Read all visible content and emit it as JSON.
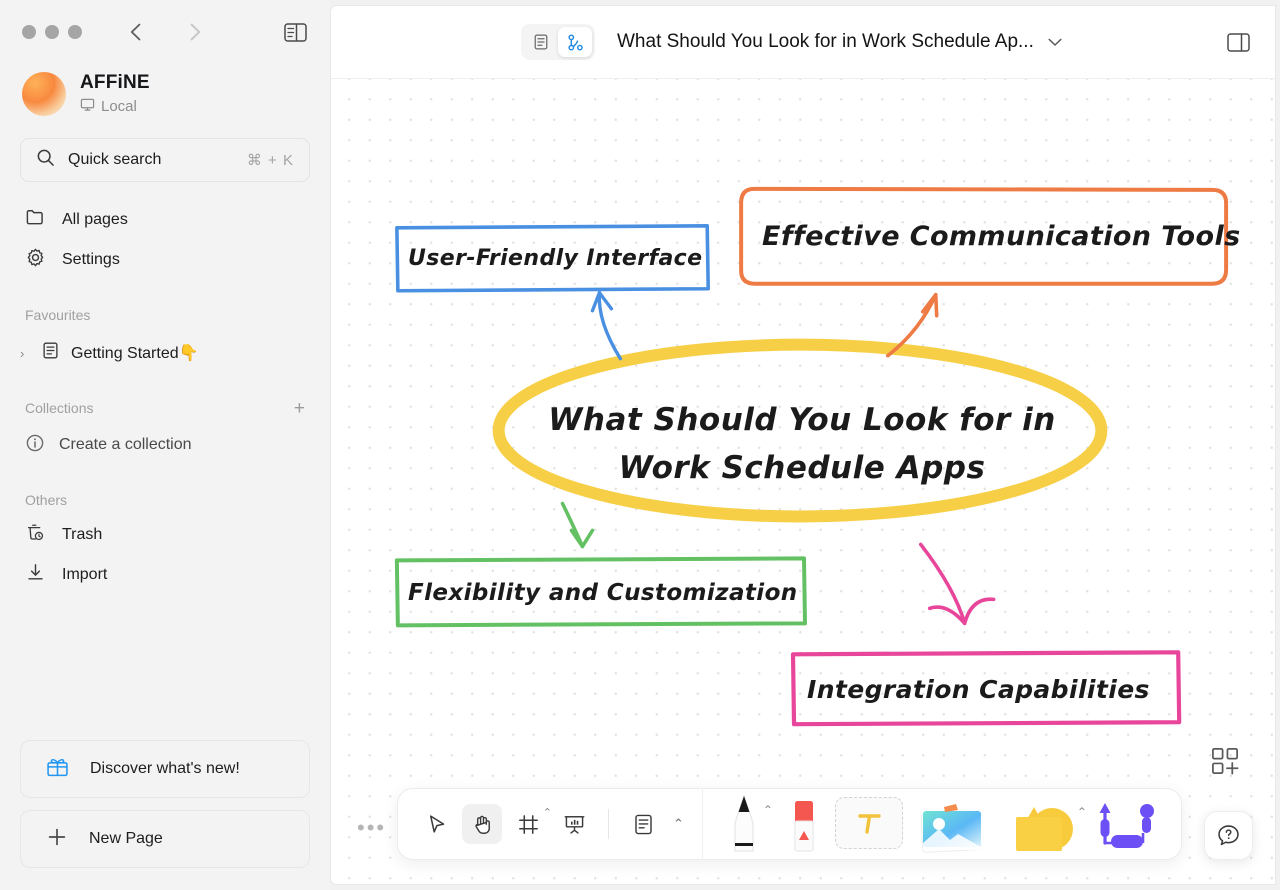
{
  "window": {
    "traffic_lights": [
      "close",
      "minimize",
      "maximize"
    ],
    "back_label": "‹",
    "forward_label": "›"
  },
  "sidebar": {
    "workspace": {
      "name": "AFFiNE",
      "sub": "Local",
      "sub_icon": "monitor-icon"
    },
    "search": {
      "placeholder": "Quick search",
      "shortcut": "⌘ + K",
      "icon": "search-icon"
    },
    "nav": [
      {
        "label": "All pages",
        "icon": "folder-icon"
      },
      {
        "label": "Settings",
        "icon": "gear-icon"
      }
    ],
    "favourites": {
      "title": "Favourites",
      "items": [
        {
          "label": "Getting Started👇",
          "icon": "doc-icon",
          "chevron": "›"
        }
      ]
    },
    "collections": {
      "title": "Collections",
      "add_label": "+",
      "items": [
        {
          "label": "Create a collection",
          "icon": "info-icon"
        }
      ]
    },
    "others": {
      "title": "Others",
      "items": [
        {
          "label": "Trash",
          "icon": "trash-icon"
        },
        {
          "label": "Import",
          "icon": "import-icon"
        }
      ]
    },
    "bottom": [
      {
        "label": "Discover what's new!",
        "icon": "gift-icon"
      },
      {
        "label": "New Page",
        "icon": "plus-icon"
      }
    ]
  },
  "header": {
    "mode_page": "page-mode-icon",
    "mode_edgeless": "edgeless-mode-icon",
    "active_mode": "edgeless",
    "doc_title": "What Should You Look for in Work Schedule Ap...",
    "title_chevron": "⌄",
    "right_toggle": "right-sidebar-toggle-icon"
  },
  "canvas": {
    "center_node": {
      "line1": "What Should You Look for in",
      "line2": "Work Schedule Apps",
      "shape": "ellipse",
      "color": "#f7cf46"
    },
    "nodes": [
      {
        "id": "user-friendly-interface",
        "text": "User-Friendly Interface",
        "color": "#4a90e2"
      },
      {
        "id": "effective-communication-tools",
        "text": "Effective Communication Tools",
        "color": "#ee7a44"
      },
      {
        "id": "flexibility-and-customization",
        "text": "Flexibility and Customization",
        "color": "#63c164"
      },
      {
        "id": "integration-capabilities",
        "text": "Integration Capabilities",
        "color": "#e8469a"
      }
    ],
    "connectors": [
      {
        "from": "center",
        "to": "user-friendly-interface",
        "color": "#4a90e2"
      },
      {
        "from": "center",
        "to": "effective-communication-tools",
        "color": "#ee7a44"
      },
      {
        "from": "center",
        "to": "flexibility-and-customization",
        "color": "#63c164"
      },
      {
        "from": "center",
        "to": "integration-capabilities",
        "color": "#e8469a"
      }
    ]
  },
  "toolbar": {
    "more_dots": "•••",
    "left_tools": [
      {
        "name": "select-tool",
        "icon": "cursor-arrow-icon",
        "active": false
      },
      {
        "name": "hand-tool",
        "icon": "hand-icon",
        "active": true
      },
      {
        "name": "frame-tool",
        "icon": "frame-icon",
        "active": false,
        "chevron": "⌃"
      },
      {
        "name": "present-tool",
        "icon": "presentation-icon",
        "active": false
      },
      {
        "name": "note-tool",
        "icon": "note-icon",
        "active": false,
        "chevron": "⌃"
      }
    ],
    "right_tools": [
      {
        "name": "pen-tool",
        "icon": "pen-icon",
        "chevron": "⌃"
      },
      {
        "name": "eraser-tool",
        "icon": "eraser-icon"
      },
      {
        "name": "text-tool",
        "icon": "text-t-icon"
      },
      {
        "name": "image-tool",
        "icon": "image-icon"
      },
      {
        "name": "shape-tool",
        "icon": "shapes-icon",
        "chevron": "⌃"
      },
      {
        "name": "connector-tool",
        "icon": "connector-icon"
      }
    ],
    "template_button": "template-add-icon",
    "help_button": "help-question-icon"
  }
}
